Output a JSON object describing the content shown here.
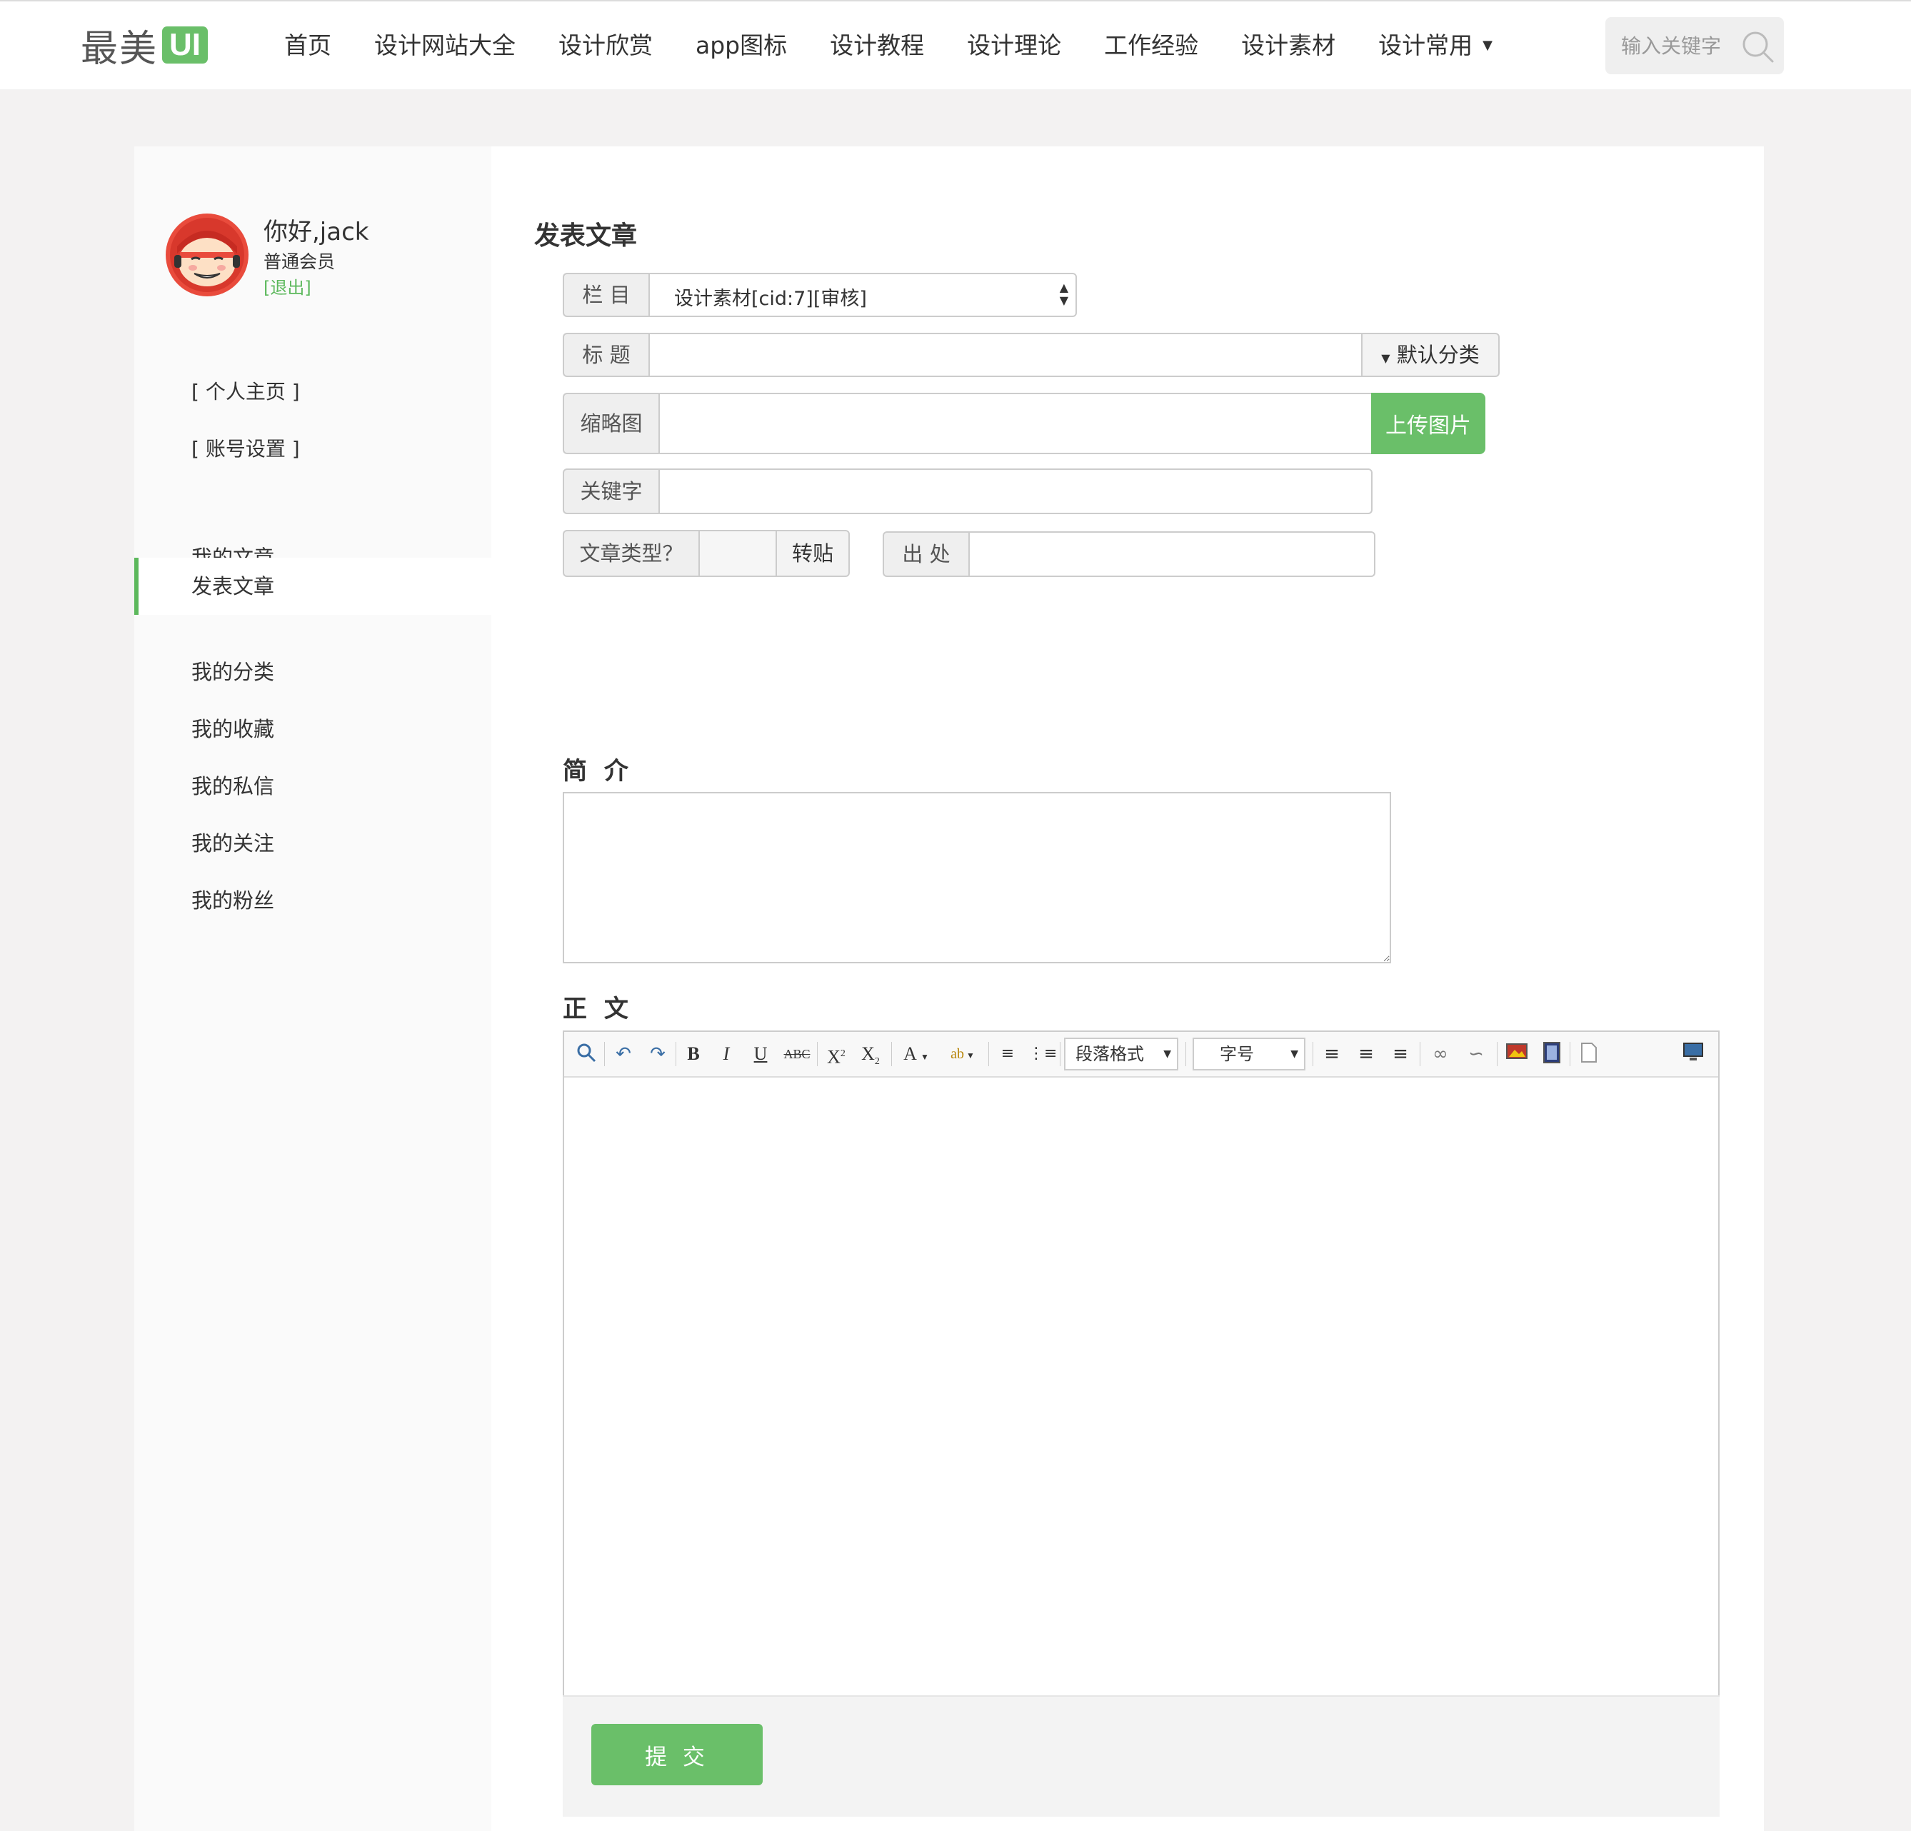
{
  "header": {
    "logo_text": "最美",
    "logo_badge": "UI",
    "nav": [
      "首页",
      "设计网站大全",
      "设计欣赏",
      "app图标",
      "设计教程",
      "设计理论",
      "工作经验",
      "设计素材",
      "设计常用"
    ],
    "search_placeholder": "输入关键字"
  },
  "user": {
    "greeting": "你好,jack",
    "level": "普通会员",
    "logout": "[退出]"
  },
  "sidebar": {
    "links": [
      "[ 个人主页 ]",
      "[ 账号设置 ]"
    ],
    "menu": [
      "我的文章",
      "发表文章",
      "我的分类",
      "我的收藏",
      "我的私信",
      "我的关注",
      "我的粉丝"
    ],
    "active_index": 1
  },
  "form": {
    "title": "发表文章",
    "column_label": "栏 目",
    "column_value": "设计素材[cid:7][审核]",
    "title_label": "标 题",
    "title_value": "",
    "category_button": "默认分类",
    "thumb_label": "缩略图",
    "thumb_value": "",
    "upload_button": "上传图片",
    "keyword_label": "关键字",
    "keyword_value": "",
    "type_label": "文章类型？",
    "type_button": "转贴",
    "source_label": "出 处",
    "source_value": "",
    "summary_label": "简 介",
    "body_label": "正 文",
    "paragraph_select": "段落格式",
    "fontsize_select": "字号",
    "submit": "提 交"
  },
  "colors": {
    "accent": "#6abf69",
    "active_border": "#5cb85c",
    "page_bg": "#f3f2f2"
  }
}
